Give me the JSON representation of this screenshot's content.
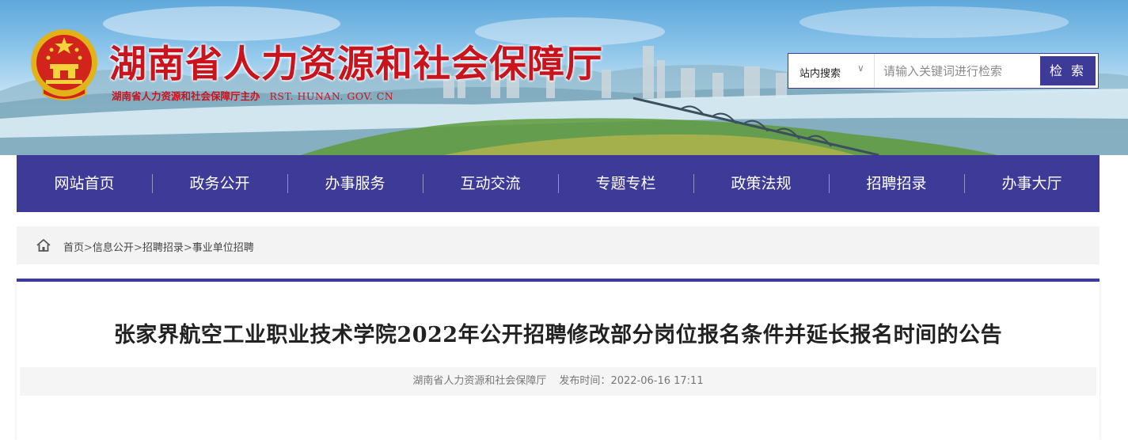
{
  "header": {
    "title": "湖南省人力资源和社会保障厅",
    "subtitle": "湖南省人力资源和社会保障厅主办",
    "domain": "RST. HUNAN. GOV. CN"
  },
  "search": {
    "scope_label": "站内搜索",
    "scope_caret": "∨",
    "placeholder": "请输入关键词进行检索",
    "button_label": "检 索"
  },
  "nav": {
    "items": [
      "网站首页",
      "政务公开",
      "办事服务",
      "互动交流",
      "专题专栏",
      "政策法规",
      "招聘招录",
      "办事大厅"
    ]
  },
  "breadcrumb": {
    "items": [
      "首页",
      "信息公开",
      "招聘招录",
      "事业单位招聘"
    ],
    "separator": ">"
  },
  "article": {
    "title": "张家界航空工业职业技术学院2022年公开招聘修改部分岗位报名条件并延长报名时间的公告",
    "source": "湖南省人力资源和社会保障厅",
    "date_label": "发布时间：",
    "date": "2022-06-16 17:11"
  },
  "colors": {
    "brand": "#3e3a97",
    "title_red": "#c9141d"
  }
}
